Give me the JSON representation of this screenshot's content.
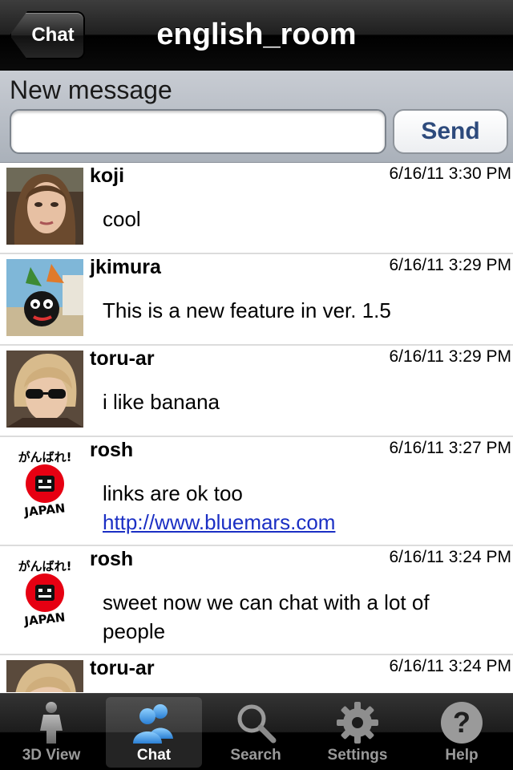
{
  "navbar": {
    "back_label": "Chat",
    "title": "english_room"
  },
  "compose": {
    "label": "New message",
    "input_value": "",
    "send_label": "Send"
  },
  "messages": [
    {
      "user": "koji",
      "time": "6/16/11 3:30 PM",
      "text": "cool",
      "avatar": "woman-brown-hair"
    },
    {
      "user": "jkimura",
      "time": "6/16/11 3:29 PM",
      "text": "This is a new feature in ver. 1.5",
      "avatar": "black-cat-3d"
    },
    {
      "user": "toru-ar",
      "time": "6/16/11 3:29 PM",
      "text": "i like banana",
      "avatar": "blonde-sunglasses"
    },
    {
      "user": "rosh",
      "time": "6/16/11 3:27 PM",
      "text": "links are ok too",
      "link": "http://www.bluemars.com",
      "avatar": "ganbare-japan"
    },
    {
      "user": "rosh",
      "time": "6/16/11 3:24 PM",
      "text": "sweet now we can chat with a lot of people",
      "avatar": "ganbare-japan"
    },
    {
      "user": "toru-ar",
      "time": "6/16/11 3:24 PM",
      "text": "",
      "avatar": "blonde-sunglasses"
    }
  ],
  "avatar_logo": {
    "top_text": "がんばれ!",
    "bottom_text": "JAPAN"
  },
  "tabs": [
    {
      "label": "3D View",
      "icon": "person-icon",
      "active": false
    },
    {
      "label": "Chat",
      "icon": "chat-users-icon",
      "active": true
    },
    {
      "label": "Search",
      "icon": "search-icon",
      "active": false
    },
    {
      "label": "Settings",
      "icon": "gear-icon",
      "active": false
    },
    {
      "label": "Help",
      "icon": "help-icon",
      "active": false
    }
  ],
  "colors": {
    "link": "#1b2fc4",
    "send_text": "#2d4a7c",
    "active_tab_icon": "#3a9be8"
  }
}
